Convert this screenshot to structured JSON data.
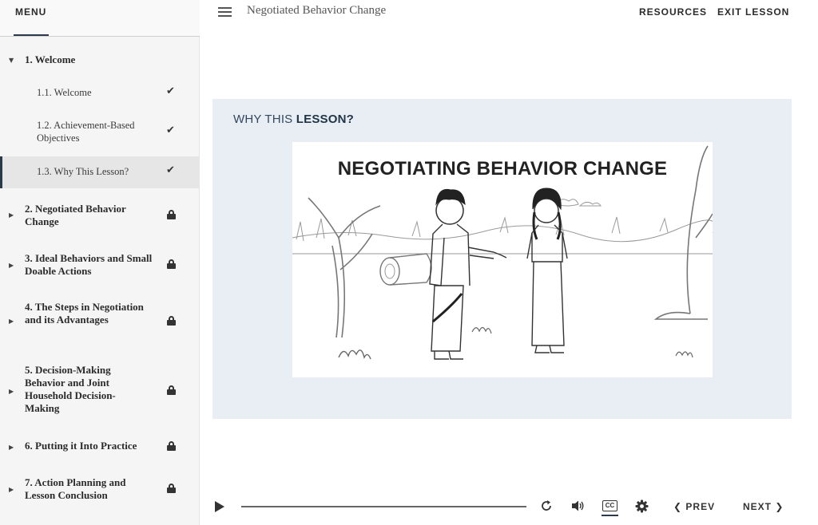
{
  "sidebar": {
    "menu_label": "MENU",
    "sections": [
      {
        "number_title": "1. Welcome",
        "state": "expanded",
        "items": [
          {
            "title": "1.1. Welcome",
            "status": "complete"
          },
          {
            "title": "1.2. Achievement-Based Objectives",
            "status": "complete"
          },
          {
            "title": "1.3. Why This Lesson?",
            "status": "complete",
            "current": true
          }
        ]
      },
      {
        "number_title": "2. Negotiated Behavior Change",
        "state": "locked"
      },
      {
        "number_title": "3. Ideal Behaviors and Small Doable Actions",
        "state": "locked"
      },
      {
        "number_title": "4. The Steps in Negotiation and its Advantages",
        "state": "locked"
      },
      {
        "number_title": "5. Decision-Making Behavior and Joint Household Decision-Making",
        "state": "locked"
      },
      {
        "number_title": "6. Putting it Into Practice",
        "state": "locked"
      },
      {
        "number_title": "7. Action Planning and Lesson Conclusion",
        "state": "locked"
      }
    ]
  },
  "header": {
    "course_title": "Negotiated Behavior Change",
    "resources_label": "RESOURCES",
    "exit_label": "EXIT LESSON"
  },
  "lesson": {
    "heading_prefix": "WHY THIS ",
    "heading_bold": "LESSON?",
    "illustration_title": "NEGOTIATING BEHAVIOR CHANGE"
  },
  "media": {
    "prev_label": "PREV",
    "next_label": "NEXT",
    "cc_label": "CC",
    "progress": 0
  },
  "icons": {
    "menu": "hamburger-icon",
    "play": "play-icon",
    "replay": "replay-icon",
    "volume": "volume-icon",
    "captions": "captions-icon",
    "settings": "gear-icon",
    "lock": "lock-icon",
    "check": "check-icon"
  }
}
